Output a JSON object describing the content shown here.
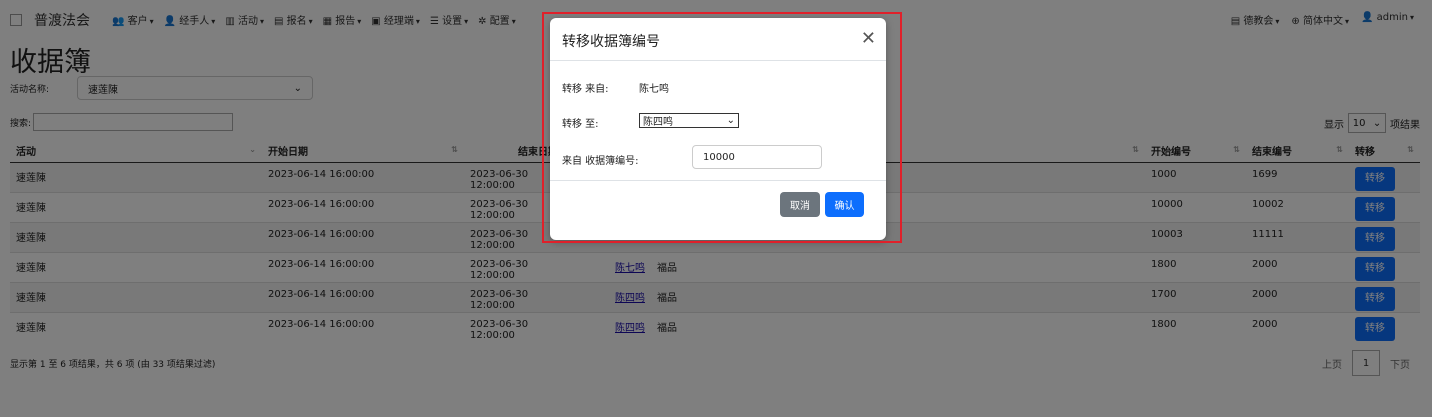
{
  "navbar": {
    "brand": "普渡法会",
    "menu": [
      {
        "icon": "users-icon",
        "glyph": "👥",
        "label": "客户"
      },
      {
        "icon": "user-icon",
        "glyph": "👤",
        "label": "经手人"
      },
      {
        "icon": "columns-icon",
        "glyph": "▥",
        "label": "活动"
      },
      {
        "icon": "file-icon",
        "glyph": "▤",
        "label": "报名"
      },
      {
        "icon": "report-icon",
        "glyph": "▦",
        "label": "报告"
      },
      {
        "icon": "briefcase-icon",
        "glyph": "▣",
        "label": "经理端"
      },
      {
        "icon": "sliders-icon",
        "glyph": "☰",
        "label": "设置"
      },
      {
        "icon": "gear-icon",
        "glyph": "✲",
        "label": "配置"
      }
    ],
    "right": [
      {
        "icon": "building-icon",
        "glyph": "▤",
        "label": "德教会"
      },
      {
        "icon": "globe-icon",
        "glyph": "⊕",
        "label": "简体中文"
      },
      {
        "icon": "user-icon",
        "glyph": "👤",
        "label": "admin"
      }
    ]
  },
  "page": {
    "title": "收据簿",
    "filter_label": "活动名称:",
    "filter_value": "速莲陳",
    "search_label": "搜索:",
    "length_prefix": "显示",
    "length_value": "10",
    "length_suffix": "项结果"
  },
  "table": {
    "headers": [
      "活动",
      "开始日期",
      "结束日期",
      "",
      "",
      "开始编号",
      "结束编号",
      "转移"
    ],
    "rows": [
      {
        "activity": "速莲陳",
        "start": "2023-06-14 16:00:00",
        "end": "2023-06-30 12:00:00",
        "person": "",
        "type": "",
        "start_no": "1000",
        "end_no": "1699",
        "action": "转移"
      },
      {
        "activity": "速莲陳",
        "start": "2023-06-14 16:00:00",
        "end": "2023-06-30 12:00:00",
        "person": "",
        "type": "",
        "start_no": "10000",
        "end_no": "10002",
        "action": "转移"
      },
      {
        "activity": "速莲陳",
        "start": "2023-06-14 16:00:00",
        "end": "2023-06-30 12:00:00",
        "person": "",
        "type": "",
        "start_no": "10003",
        "end_no": "11111",
        "action": "转移"
      },
      {
        "activity": "速莲陳",
        "start": "2023-06-14 16:00:00",
        "end": "2023-06-30 12:00:00",
        "person": "陈七鸣",
        "type": "福品",
        "start_no": "1800",
        "end_no": "2000",
        "action": "转移"
      },
      {
        "activity": "速莲陳",
        "start": "2023-06-14 16:00:00",
        "end": "2023-06-30 12:00:00",
        "person": "陈四鸣",
        "type": "福品",
        "start_no": "1700",
        "end_no": "2000",
        "action": "转移"
      },
      {
        "activity": "速莲陳",
        "start": "2023-06-14 16:00:00",
        "end": "2023-06-30 12:00:00",
        "person": "陈四鸣",
        "type": "福品",
        "start_no": "1800",
        "end_no": "2000",
        "action": "转移"
      }
    ]
  },
  "footer": {
    "info": "显示第 1 至 6 项结果，共 6 项 (由 33 项结果过滤)",
    "prev": "上页",
    "current_page": "1",
    "next": "下页"
  },
  "modal": {
    "title": "转移收据簿编号",
    "from_label": "转移 来自:",
    "from_value": "陈七鸣",
    "to_label": "转移 至:",
    "to_value": "陈四鸣",
    "source_label": "来自 收据簿编号:",
    "source_value": "10000",
    "cancel": "取消",
    "confirm": "确认"
  },
  "colors": {
    "primary": "#0d6efd",
    "secondary": "#6c757d",
    "highlight": "#e0202a"
  }
}
